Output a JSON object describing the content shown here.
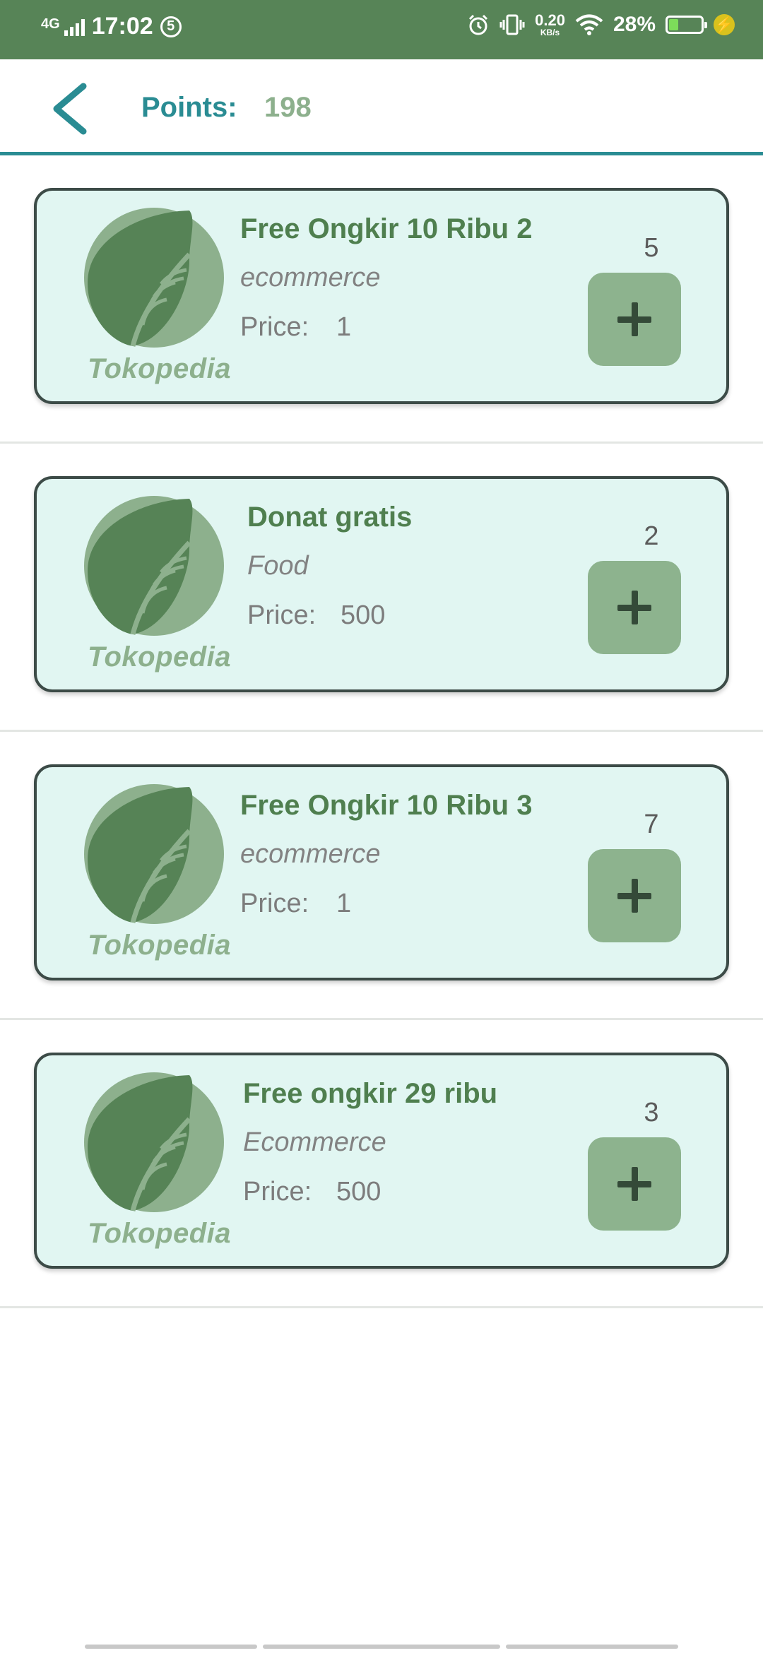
{
  "status_bar": {
    "network": "4G",
    "time": "17:02",
    "notification_badge": "5",
    "speed_value": "0.20",
    "speed_unit": "KB/s",
    "battery_percent": "28%",
    "battery_level": 0.28,
    "icons": [
      "signal-icon",
      "alarm-icon",
      "vibrate-icon",
      "wifi-icon",
      "battery-icon",
      "charging-icon"
    ]
  },
  "header": {
    "points_label": "Points:",
    "points_value": "198",
    "back_icon": "chevron-left-icon"
  },
  "vouchers": [
    {
      "title": "Free Ongkir 10 Ribu 2",
      "category": "ecommerce",
      "price_label": "Price:",
      "price": "1",
      "quantity": "5",
      "brand": "Tokopedia"
    },
    {
      "title": "Donat gratis",
      "category": "Food",
      "price_label": "Price:",
      "price": "500",
      "quantity": "2",
      "brand": "Tokopedia"
    },
    {
      "title": "Free Ongkir 10 Ribu 3",
      "category": "ecommerce",
      "price_label": "Price:",
      "price": "1",
      "quantity": "7",
      "brand": "Tokopedia"
    },
    {
      "title": "Free ongkir 29 ribu",
      "category": "Ecommerce",
      "price_label": "Price:",
      "price": "500",
      "quantity": "3",
      "brand": "Tokopedia"
    }
  ],
  "colors": {
    "status_bar": "#578457",
    "accent": "#2a8c93",
    "points_value": "#8db08d",
    "card_bg": "#e1f6f2",
    "card_border": "#3c4b47",
    "title": "#4f7f4f",
    "add_button": "#8db38e"
  }
}
